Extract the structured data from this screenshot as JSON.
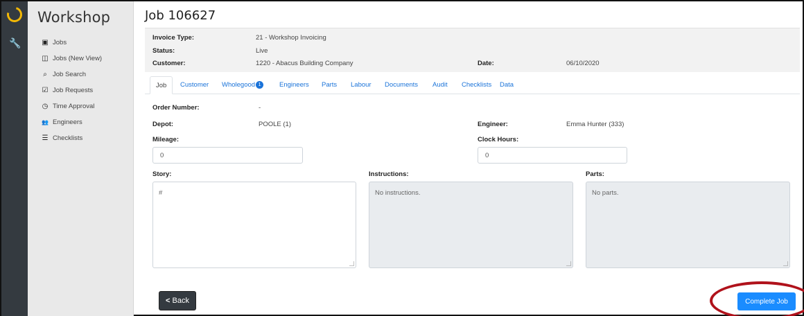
{
  "app": {
    "brand": "Workshop"
  },
  "sidebar": {
    "items": [
      {
        "label": "Jobs",
        "icon": "clipboard-icon",
        "glyph": "▣"
      },
      {
        "label": "Jobs (New View)",
        "icon": "columns-icon",
        "glyph": "◫"
      },
      {
        "label": "Job Search",
        "icon": "search-icon",
        "glyph": "⌕"
      },
      {
        "label": "Job Requests",
        "icon": "clipboard-check-icon",
        "glyph": "☑"
      },
      {
        "label": "Time Approval",
        "icon": "clock-icon",
        "glyph": "◷"
      },
      {
        "label": "Engineers",
        "icon": "users-icon",
        "glyph": "👥"
      },
      {
        "label": "Checklists",
        "icon": "list-check-icon",
        "glyph": "☰"
      }
    ]
  },
  "page": {
    "title": "Job 106627"
  },
  "summary": {
    "invoice_type_label": "Invoice Type:",
    "invoice_type_value": "21 - Workshop Invoicing",
    "status_label": "Status:",
    "status_value": "Live",
    "customer_label": "Customer:",
    "customer_value": "1220 - Abacus Building Company",
    "date_label": "Date:",
    "date_value": "06/10/2020"
  },
  "tabs": [
    {
      "label": "Job",
      "active": true
    },
    {
      "label": "Customer"
    },
    {
      "label": "Wholegood",
      "badge": "1"
    },
    {
      "label": "Engineers"
    },
    {
      "label": "Parts"
    },
    {
      "label": "Labour"
    },
    {
      "label": "Documents"
    },
    {
      "label": "Audit"
    },
    {
      "label": "Checklists"
    },
    {
      "label": "Data"
    }
  ],
  "form": {
    "order_number_label": "Order Number:",
    "order_number_value": "-",
    "depot_label": "Depot:",
    "depot_value": "POOLE (1)",
    "engineer_label": "Engineer:",
    "engineer_value": "Emma Hunter (333)",
    "mileage_label": "Mileage:",
    "mileage_value": "0",
    "clock_hours_label": "Clock Hours:",
    "clock_hours_value": "0",
    "story_label": "Story:",
    "story_value": "#",
    "instructions_label": "Instructions:",
    "instructions_value": "No instructions.",
    "parts_label": "Parts:",
    "parts_value": "No parts."
  },
  "actions": {
    "back_label": "Back",
    "complete_label": "Complete Job"
  },
  "colors": {
    "accent": "#1a8cff",
    "rail": "#343a40",
    "logo": "#f2b705",
    "highlight": "#b0121b"
  }
}
